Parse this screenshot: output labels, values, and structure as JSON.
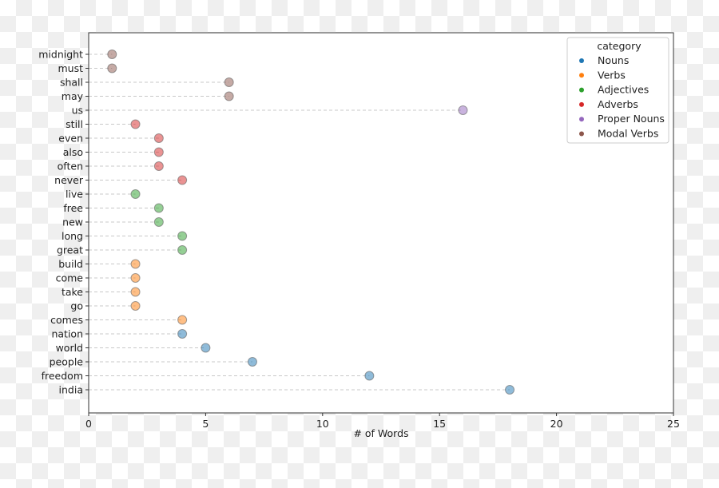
{
  "chart_data": {
    "type": "scatter",
    "style": "lollipop-horizontal",
    "xlabel": "# of Words",
    "ylabel": "",
    "xlim": [
      0,
      25
    ],
    "xticks": [
      0,
      5,
      10,
      15,
      20,
      25
    ],
    "grid": false,
    "legend": {
      "title": "category",
      "placement": "top-right",
      "entries": [
        {
          "name": "Nouns",
          "color": "#1f77b4"
        },
        {
          "name": "Verbs",
          "color": "#ff7f0e"
        },
        {
          "name": "Adjectives",
          "color": "#2ca02c"
        },
        {
          "name": "Adverbs",
          "color": "#d62728"
        },
        {
          "name": "Proper Nouns",
          "color": "#9467bd"
        },
        {
          "name": "Modal Verbs",
          "color": "#8c564b"
        }
      ]
    },
    "points": [
      {
        "word": "midnight",
        "value": 1,
        "category": "Modal Verbs"
      },
      {
        "word": "must",
        "value": 1,
        "category": "Modal Verbs"
      },
      {
        "word": "shall",
        "value": 6,
        "category": "Modal Verbs"
      },
      {
        "word": "may",
        "value": 6,
        "category": "Modal Verbs"
      },
      {
        "word": "us",
        "value": 16,
        "category": "Proper Nouns"
      },
      {
        "word": "still",
        "value": 2,
        "category": "Adverbs"
      },
      {
        "word": "even",
        "value": 3,
        "category": "Adverbs"
      },
      {
        "word": "also",
        "value": 3,
        "category": "Adverbs"
      },
      {
        "word": "often",
        "value": 3,
        "category": "Adverbs"
      },
      {
        "word": "never",
        "value": 4,
        "category": "Adverbs"
      },
      {
        "word": "live",
        "value": 2,
        "category": "Adjectives"
      },
      {
        "word": "free",
        "value": 3,
        "category": "Adjectives"
      },
      {
        "word": "new",
        "value": 3,
        "category": "Adjectives"
      },
      {
        "word": "long",
        "value": 4,
        "category": "Adjectives"
      },
      {
        "word": "great",
        "value": 4,
        "category": "Adjectives"
      },
      {
        "word": "build",
        "value": 2,
        "category": "Verbs"
      },
      {
        "word": "come",
        "value": 2,
        "category": "Verbs"
      },
      {
        "word": "take",
        "value": 2,
        "category": "Verbs"
      },
      {
        "word": "go",
        "value": 2,
        "category": "Verbs"
      },
      {
        "word": "comes",
        "value": 4,
        "category": "Verbs"
      },
      {
        "word": "nation",
        "value": 4,
        "category": "Nouns"
      },
      {
        "word": "world",
        "value": 5,
        "category": "Nouns"
      },
      {
        "word": "people",
        "value": 7,
        "category": "Nouns"
      },
      {
        "word": "freedom",
        "value": 12,
        "category": "Nouns"
      },
      {
        "word": "india",
        "value": 18,
        "category": "Nouns"
      }
    ]
  }
}
